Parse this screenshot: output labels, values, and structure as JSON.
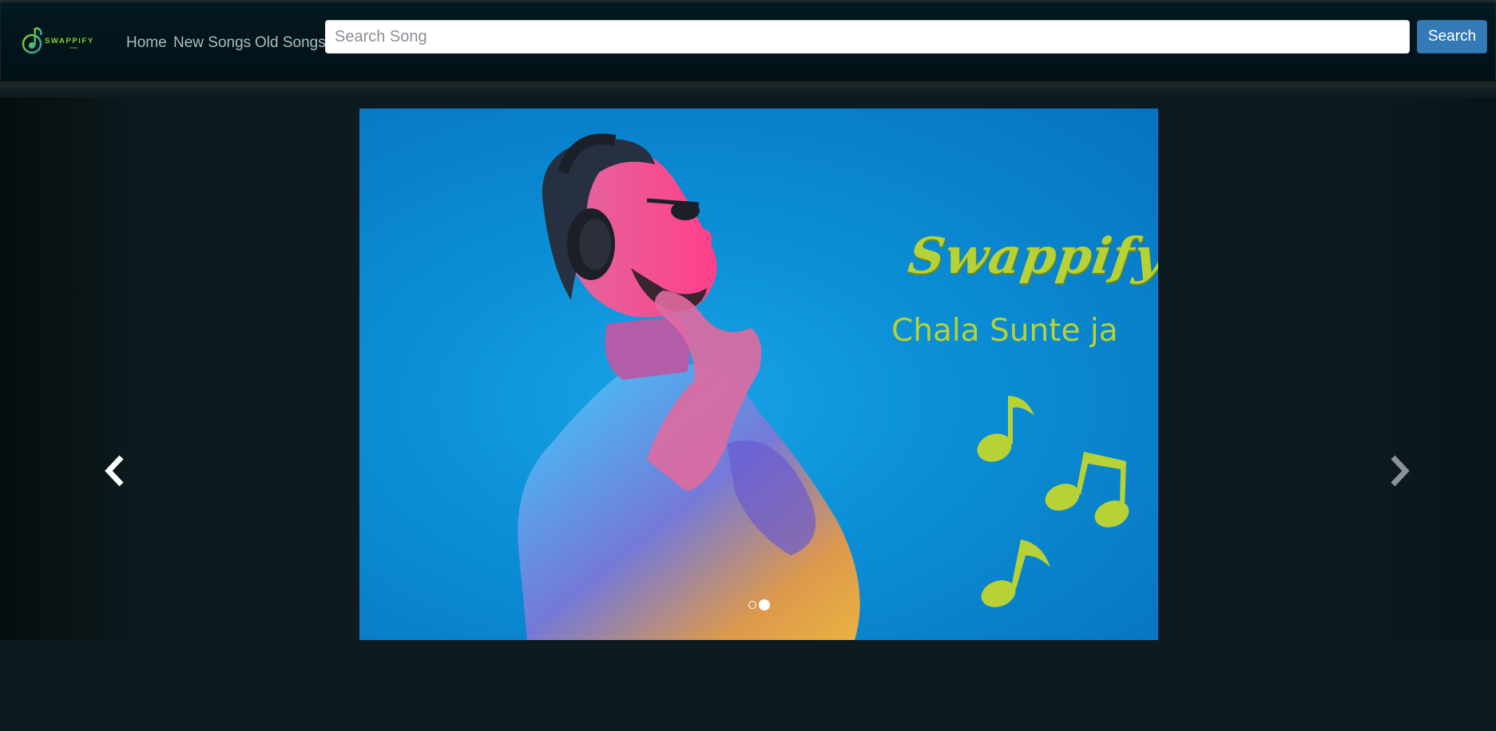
{
  "brand": {
    "logo_text": "SWAPPIFY",
    "logo_subtext": "music",
    "logo_icon": "music-note-icon",
    "accent_color": "#8ccc2a"
  },
  "nav": {
    "items": [
      {
        "label": "Home"
      },
      {
        "label": "New Songs"
      },
      {
        "label": "Old Songs"
      }
    ]
  },
  "search": {
    "placeholder": "Search Song",
    "value": "",
    "button_label": "Search"
  },
  "carousel": {
    "slide": {
      "title": "Swappify",
      "tagline": "Chala Sunte ja",
      "background_color": "#0b8fd6",
      "text_color": "#b6d236"
    },
    "prev_icon": "chevron-left-icon",
    "next_icon": "chevron-right-icon",
    "indicators": {
      "count": 2,
      "active_index": 1
    }
  }
}
